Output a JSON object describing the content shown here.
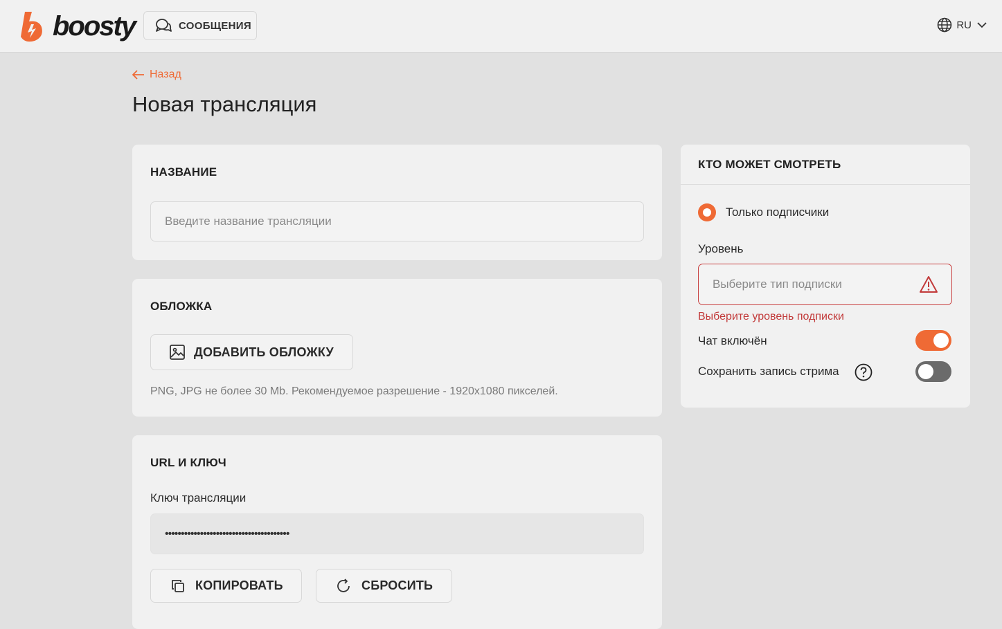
{
  "header": {
    "logo_text": "boosty",
    "messages_label": "СООБЩЕНИЯ",
    "lang_label": "RU"
  },
  "nav": {
    "back_label": "Назад"
  },
  "page": {
    "title": "Новая трансляция"
  },
  "name_card": {
    "title": "НАЗВАНИЕ",
    "input_placeholder": "Введите название трансляции"
  },
  "cover_card": {
    "title": "ОБЛОЖКА",
    "add_label": "ДОБАВИТЬ ОБЛОЖКУ",
    "hint": "PNG, JPG не более 30 Mb. Рекомендуемое разрешение - 1920x1080 пикселей."
  },
  "url_card": {
    "title": "URL И КЛЮЧ",
    "key_label": "Ключ трансляции",
    "key_value": "•••••••••••••••••••••••••••••••••••••••",
    "copy_label": "КОПИРОВАТЬ",
    "reset_label": "СБРОСИТЬ"
  },
  "access_card": {
    "title": "КТО МОЖЕТ СМОТРЕТЬ",
    "radio_label": "Только подписчики",
    "level_label": "Уровень",
    "select_placeholder": "Выберите тип подписки",
    "error_text": "Выберите уровень подписки",
    "chat_label": "Чат включён",
    "chat_enabled": true,
    "record_label": "Сохранить запись стрима",
    "record_enabled": false
  },
  "colors": {
    "accent": "#ef6a35",
    "error": "#c23a3a",
    "background": "#e1e1e1",
    "card": "#f1f1f1"
  }
}
